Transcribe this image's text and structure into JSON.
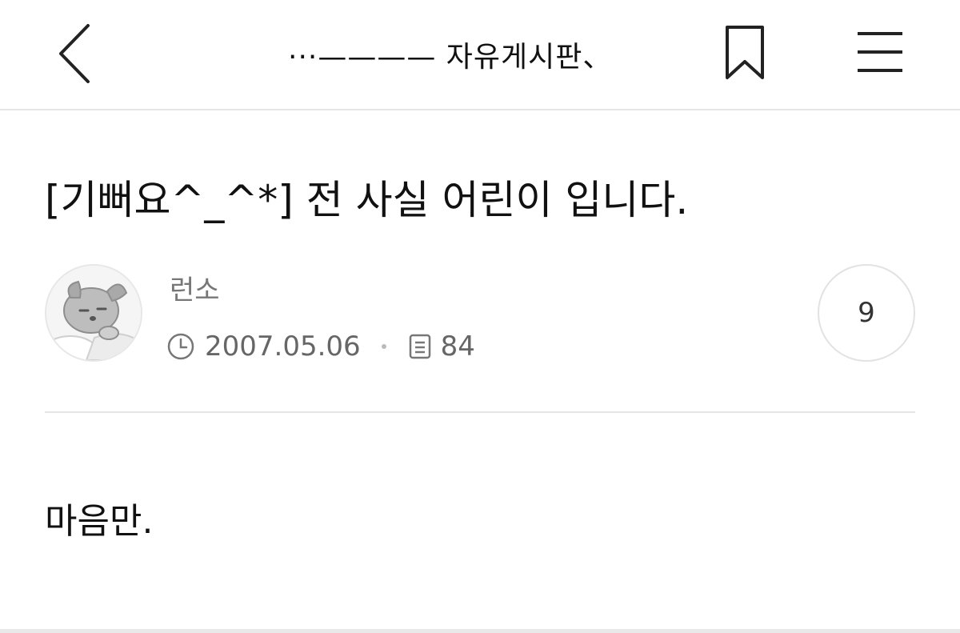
{
  "header": {
    "board_name": "···———— 자유게시판、"
  },
  "post": {
    "title": "[기뻐요^_^*] 전 사실 어린이 입니다.",
    "author": "런소",
    "date": "2007.05.06",
    "views": "84",
    "comment_count": "9",
    "body": "마음만."
  },
  "icons": {
    "back": "chevron-left-icon",
    "bookmark": "bookmark-icon",
    "menu": "hamburger-menu-icon",
    "clock": "clock-icon",
    "views": "document-icon"
  },
  "colors": {
    "text": "#111111",
    "meta": "#666666",
    "divider": "#e6e6e6"
  }
}
